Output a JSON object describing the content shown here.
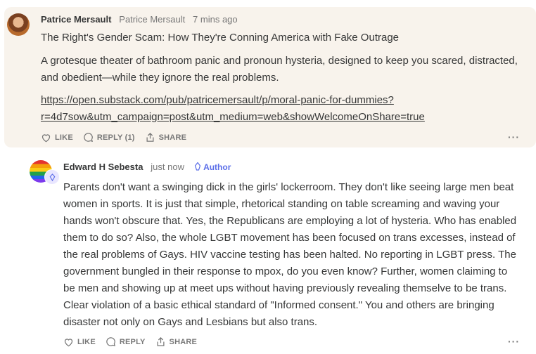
{
  "top_comment": {
    "author": "Patrice Mersault",
    "handle": "Patrice Mersault",
    "time": "7 mins ago",
    "title": "The Right's Gender Scam: How They're Conning America with Fake Outrage",
    "body": "A grotesque theater of bathroom panic and pronoun hysteria, designed to keep you scared, distracted, and obedient—while they ignore the real problems.",
    "link_line1": "https://open.substack.com/pub/patricemersault/p/moral-panic-for-dummies?",
    "link_line2": "r=4d7sow&utm_campaign=post&utm_medium=web&showWelcomeOnShare=true",
    "actions": {
      "like": "LIKE",
      "reply": "REPLY (1)",
      "share": "SHARE"
    },
    "more": "···"
  },
  "reply_comment": {
    "author": "Edward H Sebesta",
    "time": "just now",
    "badge": "Author",
    "body": "Parents don't want a swinging dick in the girls' lockerroom. They don't like seeing large men beat women in sports. It is just that simple, rhetorical standing on table screaming and waving your hands won't obscure that. Yes, the Republicans are employing a lot of hysteria. Who has enabled them to do so? Also, the whole LGBT movement has been focused on trans excesses, instead of the real problems of Gays. HIV vaccine testing has been halted. No reporting in LGBT press. The government bungled in their response to mpox, do you even know? Further, women claiming to be men and showing up at meet ups without having previously revealing themselve to be trans. Clear violation of a basic ethical standard of \"Informed consent.\" You and others are bringing disaster not only on Gays and Lesbians but also trans.",
    "actions": {
      "like": "LIKE",
      "reply": "REPLY",
      "share": "SHARE"
    },
    "more": "···"
  }
}
